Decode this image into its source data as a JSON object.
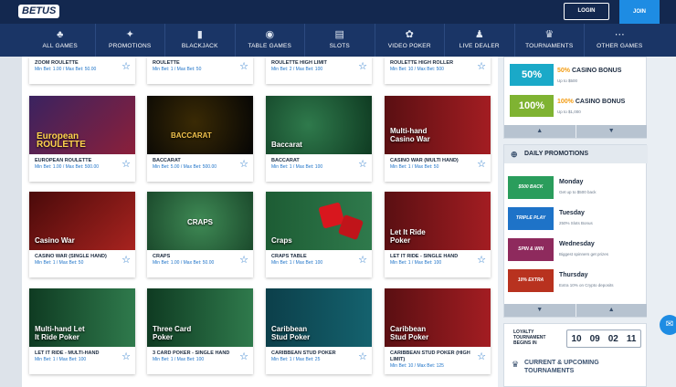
{
  "header": {
    "logo": "BETUS",
    "login": "LOGIN",
    "join": "JOIN"
  },
  "nav": [
    {
      "label": "ALL GAMES",
      "icon": "♣"
    },
    {
      "label": "PROMOTIONS",
      "icon": "✦"
    },
    {
      "label": "BLACKJACK",
      "icon": "▮"
    },
    {
      "label": "TABLE GAMES",
      "icon": "◉"
    },
    {
      "label": "SLOTS",
      "icon": "▤"
    },
    {
      "label": "VIDEO POKER",
      "icon": "✿"
    },
    {
      "label": "LIVE DEALER",
      "icon": "♟"
    },
    {
      "label": "TOURNAMENTS",
      "icon": "♛"
    },
    {
      "label": "OTHER GAMES",
      "icon": "⋯"
    }
  ],
  "games": [
    {
      "name": "ZOOM ROULETTE",
      "bet": "Min Bet: 1.00 / Max Bet: 50.00",
      "thumb": ""
    },
    {
      "name": "ROULETTE",
      "bet": "Min Bet: 1 / Max Bet: 50",
      "thumb": ""
    },
    {
      "name": "ROULETTE HIGH LIMIT",
      "bet": "Min Bet: 2 / Max Bet: 100",
      "thumb": ""
    },
    {
      "name": "ROULETTE HIGH ROLLER",
      "bet": "Min Bet: 10 / Max Bet: 500",
      "thumb": ""
    },
    {
      "name": "EUROPEAN ROULETTE",
      "bet": "Min Bet: 1.00 / Max Bet: 500.00",
      "thumb": "European ROULETTE"
    },
    {
      "name": "BACCARAT",
      "bet": "Min Bet: 5.00 / Max Bet: 500.00",
      "thumb": "BACCARAT"
    },
    {
      "name": "BACCARAT",
      "bet": "Min Bet: 1 / Max Bet: 100",
      "thumb": "Baccarat"
    },
    {
      "name": "CASINO WAR (MULTI HAND)",
      "bet": "Min Bet: 1 / Max Bet: 50",
      "thumb": "Multi-hand Casino War"
    },
    {
      "name": "CASINO WAR (SINGLE HAND)",
      "bet": "Min Bet: 1 / Max Bet: 50",
      "thumb": "Casino War"
    },
    {
      "name": "CRAPS",
      "bet": "Min Bet: 1.00 / Max Bet: 50.00",
      "thumb": "CRAPS"
    },
    {
      "name": "CRAPS TABLE",
      "bet": "Min Bet: 1 / Max Bet: 100",
      "thumb": "Craps"
    },
    {
      "name": "LET IT RIDE - SINGLE HAND",
      "bet": "Min Bet: 1 / Max Bet: 100",
      "thumb": "Let It Ride Poker"
    },
    {
      "name": "LET IT RIDE - MULTI-HAND",
      "bet": "Min Bet: 1 / Max Bet: 100",
      "thumb": "Multi-hand Let It Ride Poker"
    },
    {
      "name": "3 CARD POKER - SINGLE HAND",
      "bet": "Min Bet: 1 / Max Bet: 100",
      "thumb": "Three Card Poker"
    },
    {
      "name": "CARIBBEAN STUD POKER",
      "bet": "Min Bet: 1 / Max Bet: 25",
      "thumb": "Caribbean Stud Poker"
    },
    {
      "name": "CARIBBEAN STUD POKER (HIGH LIMIT)",
      "bet": "Min Bet: 10 / Max Bet: 125",
      "thumb": "Caribbean Stud Poker"
    }
  ],
  "bonuses": [
    {
      "badge": "50%",
      "pct": "50%",
      "title": " CASINO BONUS",
      "sub": "Up to $500",
      "color": "#1aa9c8"
    },
    {
      "badge": "100%",
      "pct": "100%",
      "title": " CASINO BONUS",
      "sub": "Up to $1,000",
      "color": "#7fb332"
    }
  ],
  "daily": {
    "title": "DAILY PROMOTIONS",
    "items": [
      {
        "img": "$500 BACK",
        "day": "Monday",
        "desc": "Get up to $500 back",
        "color": "#2a9d5c"
      },
      {
        "img": "TRIPLE PLAY",
        "day": "Tuesday",
        "desc": "250% Slots Bonus",
        "color": "#1e73c8"
      },
      {
        "img": "SPIN & WIN",
        "day": "Wednesday",
        "desc": "Biggest spinners get prizes",
        "color": "#8e2a5d"
      },
      {
        "img": "10% EXTRA",
        "day": "Thursday",
        "desc": "Extra 10% on Crypto deposits",
        "color": "#b8321f"
      }
    ]
  },
  "loyalty": {
    "title": "LOYALTY TOURNAMENT BEGINS IN",
    "timer": [
      "10",
      "09",
      "02",
      "11"
    ]
  },
  "current": {
    "title": "CURRENT & UPCOMING TOURNAMENTS"
  },
  "colors": {
    "header": "#13284f",
    "nav": "#1a3566",
    "accent": "#1e8ce3",
    "bet_text": "#1e73c8"
  }
}
